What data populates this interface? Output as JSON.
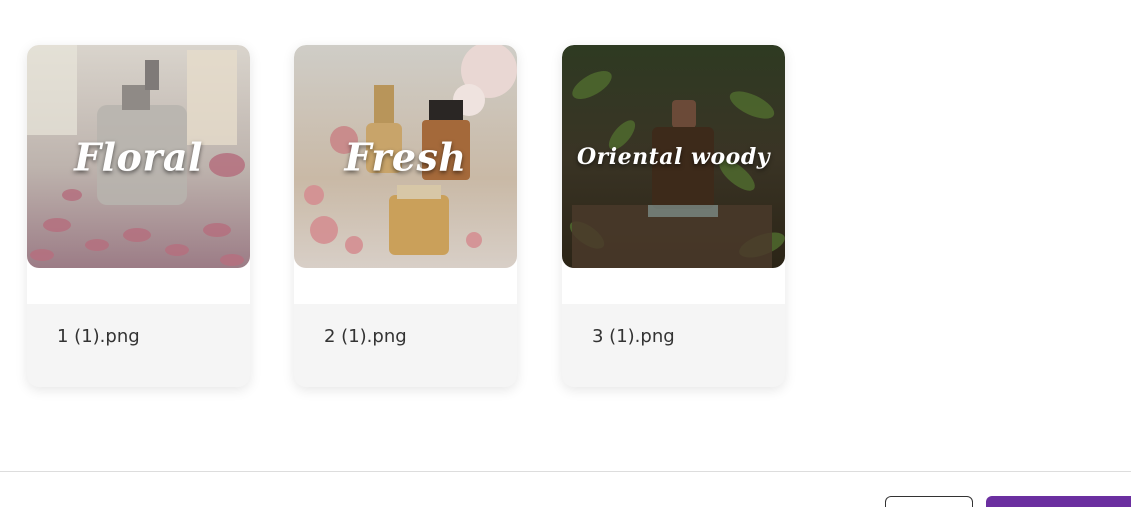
{
  "files": [
    {
      "name": "1 (1).png",
      "overlay_text": "Floral"
    },
    {
      "name": "2 (1).png",
      "overlay_text": "Fresh"
    },
    {
      "name": "3 (1).png",
      "overlay_text": "Oriental woody"
    }
  ],
  "footer": {
    "cancel_label": "",
    "confirm_label": ""
  },
  "colors": {
    "accent": "#6b2fa0",
    "card_bg": "#f5f5f5",
    "divider": "#dddddd"
  }
}
